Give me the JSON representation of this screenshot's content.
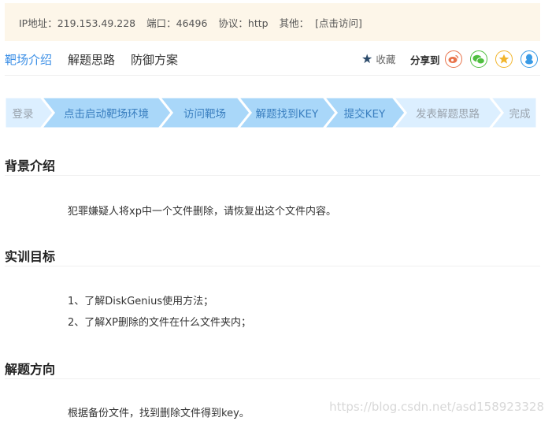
{
  "info": {
    "ip": "IP地址：219.153.49.228",
    "port": "端口：46496",
    "protocol": "协议：http",
    "other_label": "其他：",
    "other_link": "[点击访问]"
  },
  "tabs": [
    {
      "label": "靶场介绍",
      "active": true
    },
    {
      "label": "解题思路",
      "active": false
    },
    {
      "label": "防御方案",
      "active": false
    }
  ],
  "actions": {
    "favorite": "收藏",
    "share": "分享到",
    "share_icons": [
      "weibo-icon",
      "wechat-icon",
      "qzone-icon",
      "qq-icon"
    ]
  },
  "steps": [
    {
      "label": "登录",
      "state": "light"
    },
    {
      "label": "点击启动靶场环境",
      "state": "active"
    },
    {
      "label": "访问靶场",
      "state": "active"
    },
    {
      "label": "解题找到KEY",
      "state": "active"
    },
    {
      "label": "提交KEY",
      "state": "active"
    },
    {
      "label": "发表解题思路",
      "state": "light"
    },
    {
      "label": "完成",
      "state": "light"
    }
  ],
  "sections": {
    "background": {
      "title": "背景介绍",
      "text": "犯罪嫌疑人将xp中一个文件删除，请恢复出这个文件内容。"
    },
    "goals": {
      "title": "实训目标",
      "items": [
        "1、了解DiskGenius使用方法；",
        "2、了解XP删除的文件在什么文件夹内；"
      ]
    },
    "direction": {
      "title": "解题方向",
      "text": "根据备份文件，找到删除文件得到key。"
    }
  },
  "watermark": "https://blog.csdn.net/asd158923328",
  "colors": {
    "accent": "#3a8ee6",
    "step_active": "#a9d7f9",
    "step_light": "#dcefff",
    "step_active_text": "#3a7fc0",
    "step_light_text": "#9aa3ad",
    "info_bg": "#fdf6e9"
  }
}
